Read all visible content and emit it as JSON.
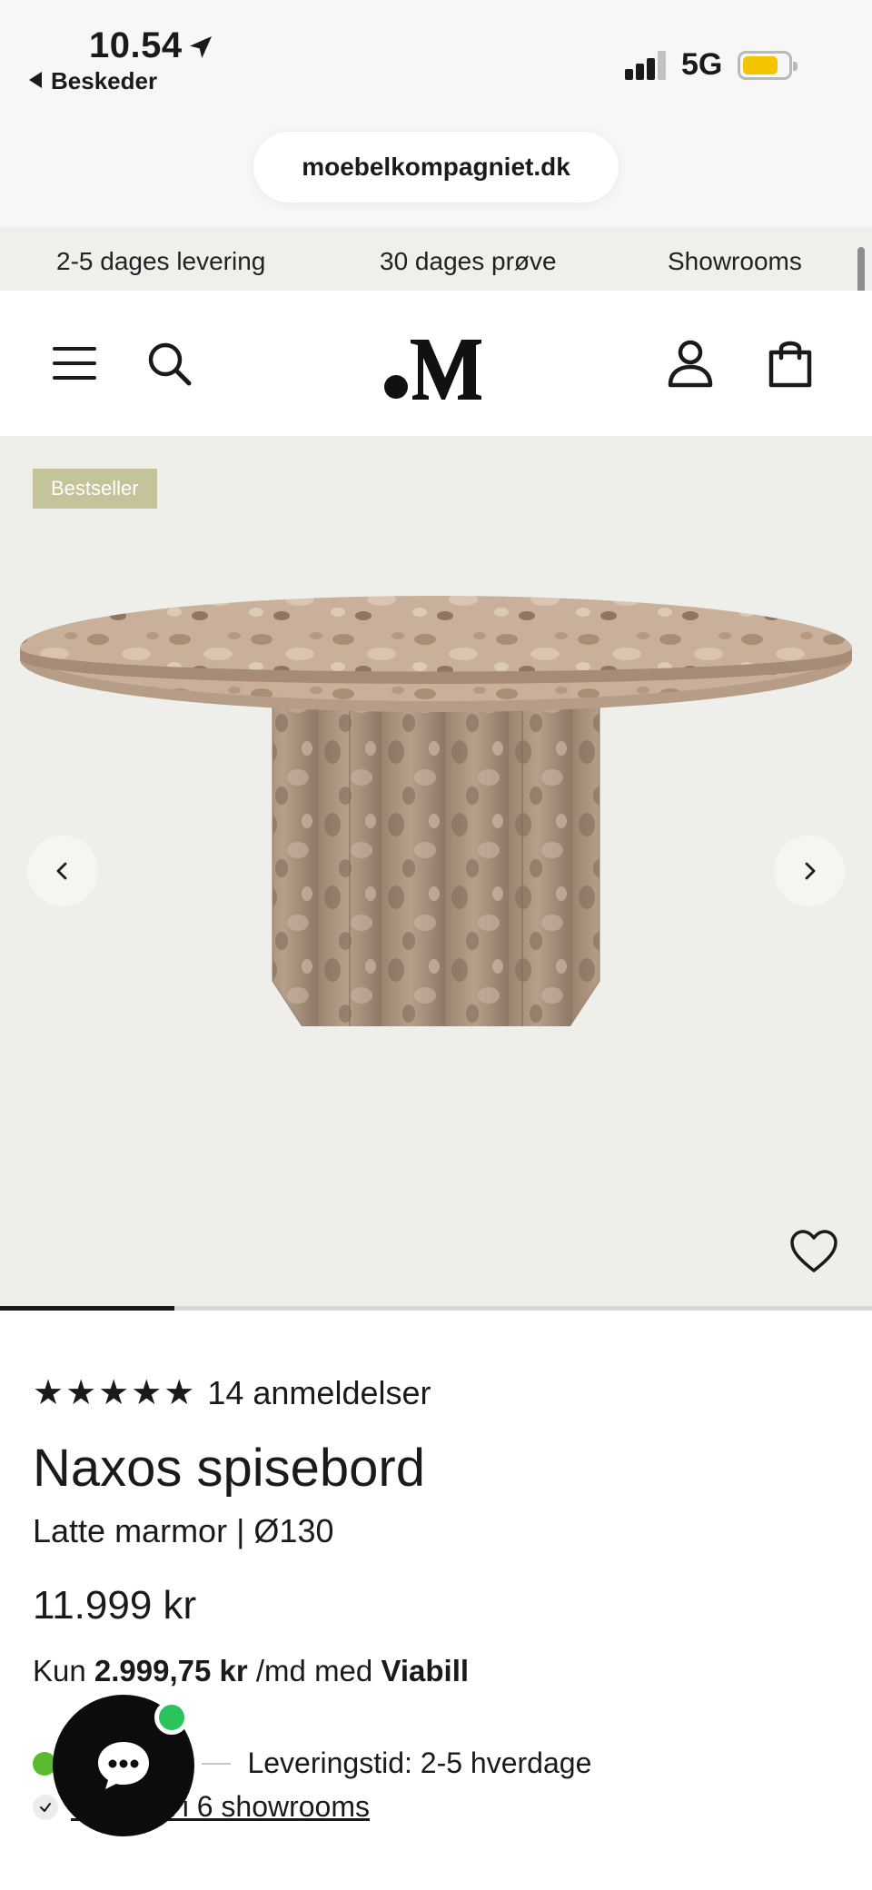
{
  "status_bar": {
    "time": "10.54",
    "back_label": "Beskeder",
    "network": "5G",
    "battery_level": 0.8,
    "battery_color": "#f5c400"
  },
  "browser": {
    "url": "moebelkompagniet.dk"
  },
  "usp_bar": {
    "items": [
      "2-5 dages levering",
      "30 dages prøve",
      "Showrooms"
    ]
  },
  "header": {
    "logo_text": ".M",
    "icons": [
      "menu-icon",
      "search-icon",
      "account-icon",
      "cart-icon"
    ]
  },
  "gallery": {
    "badge": "Bestseller",
    "badge_color": "#c4c39a",
    "image_progress": 0.2
  },
  "product": {
    "stars": "★★★★★",
    "review_count": "14 anmeldelser",
    "title": "Naxos spisebord",
    "variant": "Latte marmor | Ø130",
    "price": "11.999 kr",
    "financing": {
      "prefix": "Kun",
      "amount": "2.999,75 kr",
      "middle": "/md med",
      "provider": "Viabill"
    },
    "stock_label": "er",
    "delivery": "Leveringstid: 2-5 hverdage",
    "showroom_link": "Udstillet i 6 showrooms",
    "stock_color": "#5bbb2e"
  },
  "chat": {
    "online_color": "#2ac35c"
  }
}
